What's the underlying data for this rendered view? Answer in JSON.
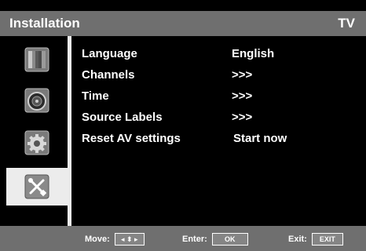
{
  "header": {
    "title": "Installation",
    "mode": "TV"
  },
  "sidebar": {
    "items": [
      {
        "icon": "picture-settings-icon",
        "active": false
      },
      {
        "icon": "sound-settings-icon",
        "active": false
      },
      {
        "icon": "features-gear-icon",
        "active": false
      },
      {
        "icon": "installation-tools-icon",
        "active": true
      }
    ]
  },
  "menu": {
    "rows": [
      {
        "label": "Language",
        "value": "English"
      },
      {
        "label": "Channels",
        "value": ">>>"
      },
      {
        "label": "Time",
        "value": ">>>"
      },
      {
        "label": "Source Labels",
        "value": ">>>"
      },
      {
        "label": "Reset AV settings",
        "value": "Start now"
      }
    ]
  },
  "footer": {
    "move_label": "Move:",
    "move_key": "◂ ⬍ ▸",
    "enter_label": "Enter:",
    "enter_key": "OK",
    "exit_label": "Exit:",
    "exit_key": "EXIT"
  },
  "colors": {
    "bar": "#6f6f6f",
    "highlight": "#ececec",
    "background": "#000000"
  }
}
